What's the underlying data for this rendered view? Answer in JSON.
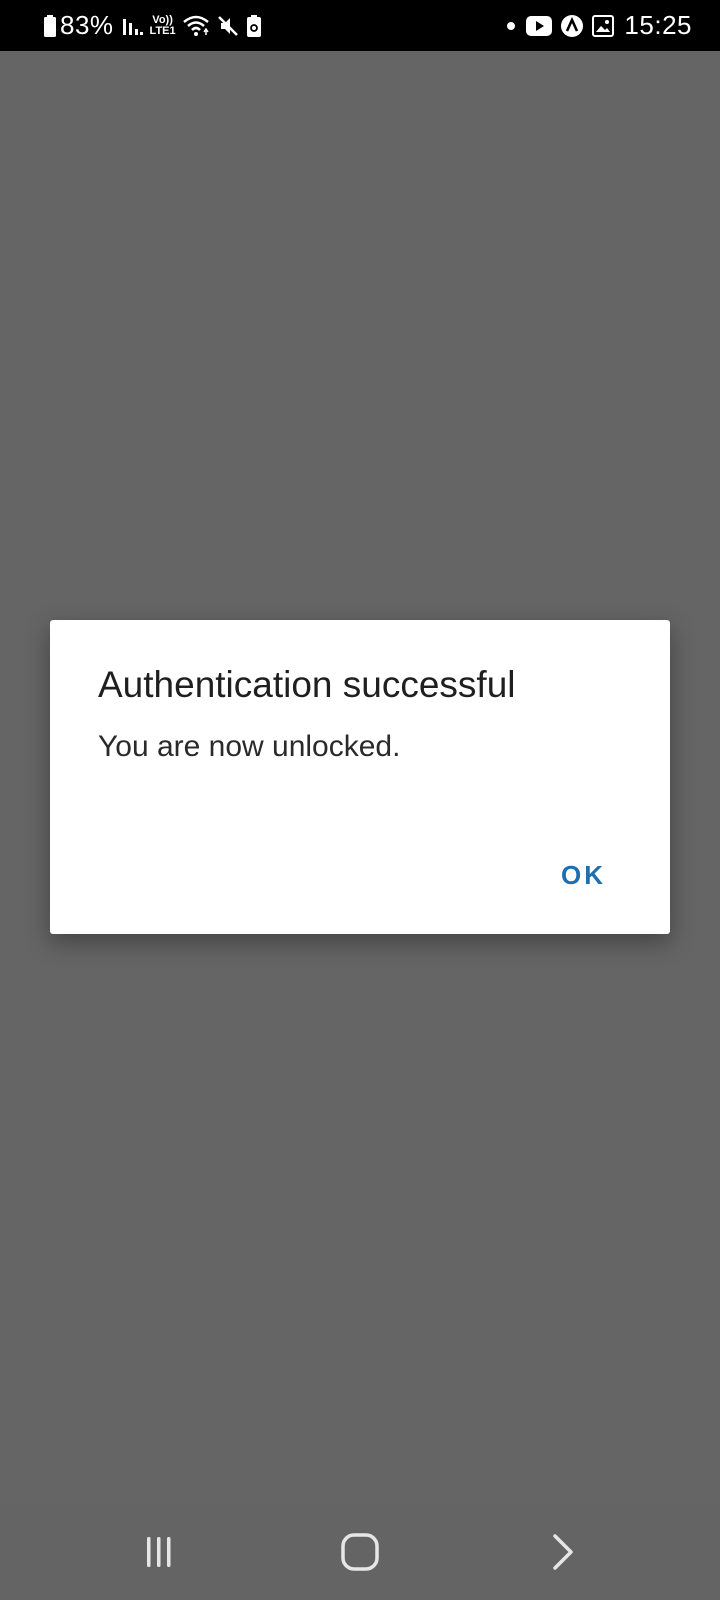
{
  "status_bar": {
    "battery_percent": "83%",
    "network_label": "LTE1",
    "volte_label": "Vo))",
    "time": "15:25",
    "icons": [
      "battery-icon",
      "signal-icon",
      "volte-icon",
      "wifi-icon",
      "mute-icon",
      "battery-saver-icon",
      "notification-dot-icon",
      "youtube-icon",
      "app-a-icon",
      "gallery-icon"
    ]
  },
  "dialog": {
    "title": "Authentication successful",
    "message": "You are now unlocked.",
    "ok_label": "OK",
    "accent_color": "#1e6fb0"
  },
  "nav_bar": {
    "icons": [
      "recents-icon",
      "home-icon",
      "back-icon"
    ]
  },
  "colors": {
    "scrim": "#656565",
    "status_bar_bg": "#000000",
    "dialog_bg": "#ffffff"
  }
}
